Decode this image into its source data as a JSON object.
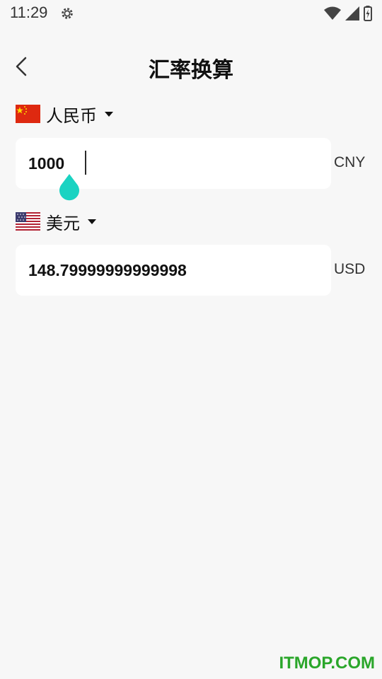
{
  "status_bar": {
    "time": "11:29",
    "icons": [
      "gear-icon",
      "wifi-icon",
      "signal-icon",
      "battery-icon"
    ]
  },
  "header": {
    "title": "汇率换算",
    "back_icon": "chevron-left-icon"
  },
  "from": {
    "currency_name": "人民币",
    "amount": "1000",
    "code": "CNY",
    "flag": "china-flag-icon"
  },
  "to": {
    "currency_name": "美元",
    "amount": "148.79999999999998",
    "code": "USD",
    "flag": "usa-flag-icon"
  },
  "colors": {
    "background": "#f7f7f7",
    "card": "#ffffff",
    "text_handle": "#1ad3c2",
    "watermark": "#2aa62a"
  },
  "watermark": "ITMOP.COM"
}
